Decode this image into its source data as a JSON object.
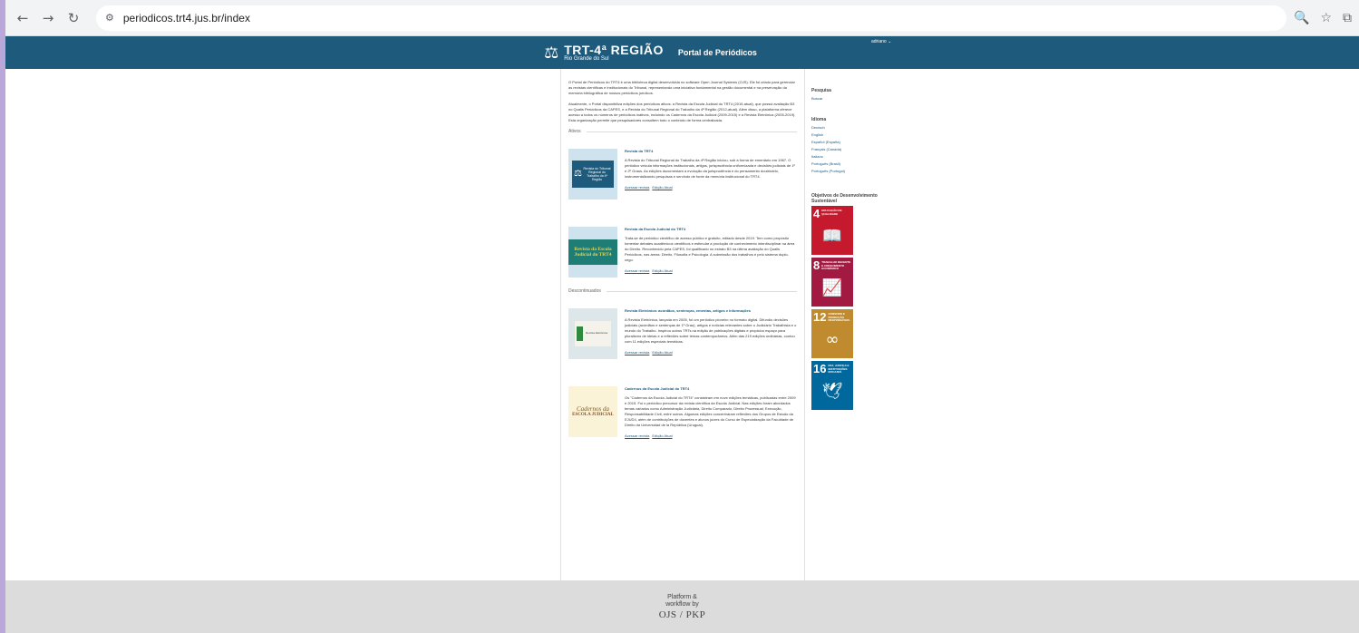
{
  "browser": {
    "url": "periodicos.trt4.jus.br/index"
  },
  "header": {
    "logo_main": "TRT-4ª REGIÃO",
    "logo_sub": "Rio Grande do Sul",
    "portal_title": "Portal de Periódicos",
    "user_menu": "adriano ⌄"
  },
  "intro": {
    "p1": "O Portal de Periódicos do TRT4 é uma biblioteca digital desenvolvida no software Open Journal Systems (OJS). Ele foi criado para gerenciar as revistas científicas e institucionais do Tribunal, representando uma iniciativa fundamental na gestão documental e na preservação da memória bibliográfica de nossos periódicos jurídicos.",
    "p2": "Atualmente, o Portal disponibiliza edições dos periódicos ativos: a Revista da Escola Judicial do TRT4 (2019-atual), que possui avaliação B3 no Qualis Periódicos da CAPES, e a Revista do Tribunal Regional do Trabalho da 4ª Região (2012-atual). Além disso, a plataforma oferece acesso a todos os números de periódicos inativos, incluindo os Cadernos da Escola Judicial (2009-2015) e a Revista Eletrônica (2005-2019). Esta organização permite que pesquisadores consultem todo o conteúdo de forma centralizada."
  },
  "sections": {
    "active": "Ativos",
    "discontinued": "Descontinuados"
  },
  "journals": [
    {
      "title": "Revista do TRT4",
      "desc": "A Revista do Tribunal Regional do Trabalho da 4ª Região iniciou, sob a forma de ementário em 1967. O periódico veicula informações institucionais, artigos, jurisprudência uniformizada e decisões judiciais de 1º e 2º Graus. As edições documentam a evolução da jurisprudência e do pensamento doutrinário, instrumentalizando pesquisas e servindo de fonte da memória institucional do TRT4.",
      "link1": "Acessar revista",
      "link2": "Edição Atual",
      "cover_text": "Revista do Tribunal Regional do Trabalho da 4ª Região"
    },
    {
      "title": "Revista da Escola Judicial do TRT4",
      "desc": "Trata-se de periódico científico de acesso público e gratuito, editado desde 2019. Tem como propósito fomentar debates acadêmicos científicos e estimular a produção de conhecimento interdisciplinar na área do Direito. Reconhecido pela CAPES, foi qualificado no estrato B3 na última avaliação do Qualis Periódicos, nas áreas: Direito, Filosofia e Psicologia. A submissão dos trabalhos é pelo sistema duplo-cego.",
      "link1": "Acessar revista",
      "link2": "Edição Atual",
      "cover_text": "Revista da Escola Judicial do TRT4"
    },
    {
      "title": "Revista Eletrônica: acórdãos, sentenças, ementas, artigos e informações",
      "desc": "A Revista Eletrônica, lançada em 2005, foi um periódico pioneiro no formato digital. Difundiu decisões judiciais (acórdãos e sentenças de 1º Grau), artigos e notícias relevantes sobre o Judiciário Trabalhista e o mundo do Trabalho. Inspirou outros TRTs na edição de publicações digitais e propiciou espaço para pluralismo de ideias e a reflexões sobre temas contemporâneos. Além das 219 edições ordinárias, contou com 11 edições especiais temáticas.",
      "link1": "Acessar revista",
      "link2": "Edição Atual",
      "cover_text": "Revista Eletrônica"
    },
    {
      "title": "Cadernos da Escola Judicial do TRT4",
      "desc": "Os \"Cadernos da Escola Judicial do TRT4\" consistiram em nove edições temáticas, publicadas entre 2009 e 2015. Foi o periódico precursor da revista científica da Escola Judicial. Nas edições foram abordados temas variados como Administração Judiciária, Direito Comparado, Direito Processual, Execução, Responsabilidade Civil, entre outros. Algumas edições concentraram reflexões dos Grupos de Estudo da EJUD4, além de contribuições de docentes e alunos juízes do Curso de Especialização da Faculdade de Direito da Universidad de la República (Uruguai).",
      "link1": "Acessar revista",
      "link2": "Edição Atual",
      "cover_text1": "Cadernos da",
      "cover_text2": "ESCOLA JUDICIAL"
    }
  ],
  "sidebar": {
    "search_title": "Pesquisa",
    "search_link": "Buscar",
    "lang_title": "Idioma",
    "languages": [
      "Deutsch",
      "English",
      "Español (España)",
      "Français (Canada)",
      "Italiano",
      "Português (Brasil)",
      "Português (Portugal)"
    ],
    "sdg_title": "Objetivos de Desenvolvimento Sustentável",
    "sdgs": [
      {
        "num": "4",
        "label": "EDUCAÇÃO DE QUALIDADE",
        "color": "#c5192d",
        "icon": "book-icon"
      },
      {
        "num": "8",
        "label": "TRABALHO DECENTE E CRESCIMENTO ECONÔMICO",
        "color": "#a21942",
        "icon": "growth-chart-icon"
      },
      {
        "num": "12",
        "label": "CONSUMO E PRODUÇÃO RESPONSÁVEIS",
        "color": "#bf8b2e",
        "icon": "infinity-icon"
      },
      {
        "num": "16",
        "label": "PAZ, JUSTIÇA E INSTITUIÇÕES EFICAZES",
        "color": "#00689d",
        "icon": "dove-icon"
      }
    ]
  },
  "footer": {
    "line1": "Platform &",
    "line2": "workflow by",
    "brand": "OJS / PKP"
  }
}
